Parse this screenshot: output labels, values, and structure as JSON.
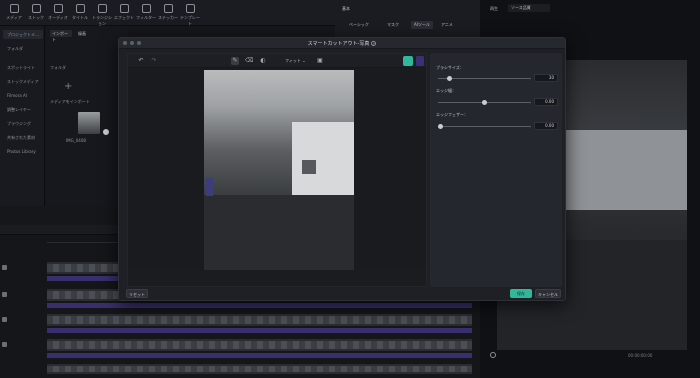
{
  "toolbar": {
    "items": [
      "メディア",
      "ストック",
      "オーディオ",
      "タイトル",
      "トランジション",
      "エフェクト",
      "フィルター",
      "ステッカー",
      "テンプレート"
    ]
  },
  "left_panel": {
    "items": [
      "プロジェクトメ…",
      "フォルダ",
      "スポットライト",
      "ストックメディア",
      "Filmora AI",
      "調整レイヤー",
      "ブラウジング",
      "共有された素材",
      "Photos Library"
    ]
  },
  "media_panel": {
    "tabs": [
      "インポート",
      "録画"
    ],
    "folder_label": "フォルダ",
    "import_label": "メディアをインポート",
    "clip_name": "IMG_0408"
  },
  "right_props": {
    "tabs": [
      "基本",
      "ベーシック",
      "マスク",
      "AIツール",
      "アニメ"
    ]
  },
  "preview": {
    "top_labels": [
      "再生",
      "ソース品質"
    ],
    "timecode": "00:00:00:00"
  },
  "dialog": {
    "title": "スマートカットアウト-写真",
    "help": "?",
    "fit_label": "フィット",
    "settings": {
      "brush_size_label": "ブラシサイズ：",
      "brush_size_value": "30",
      "brush_size_fraction": 0.1,
      "edge_width_label": "エッジ幅：",
      "edge_width_value": "0.00",
      "edge_width_fraction": 0.5,
      "edge_feather_label": "エッジフェザー：",
      "edge_feather_value": "0.00",
      "edge_feather_fraction": 0.0
    },
    "buttons": {
      "reset": "リセット",
      "save": "保存",
      "cancel": "キャンセル"
    }
  }
}
